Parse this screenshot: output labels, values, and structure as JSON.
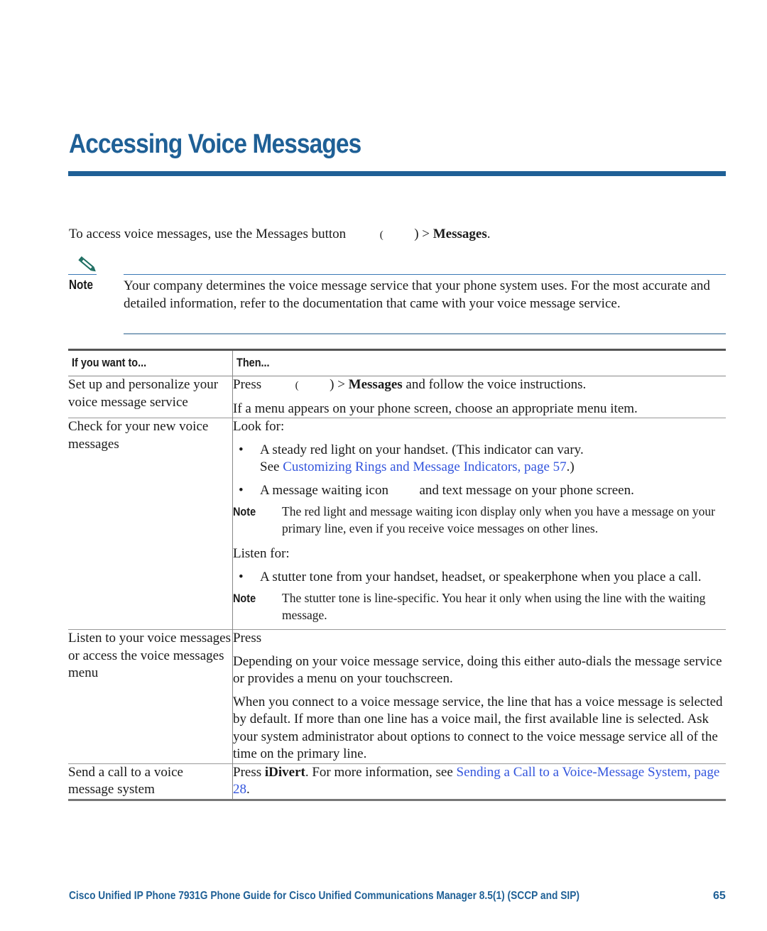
{
  "page": {
    "title": "Accessing Voice Messages",
    "accent_color": "#1f6096",
    "link_color": "#3355dd"
  },
  "intro": {
    "text": "To access voice messages, use the Messages button",
    "paren_open": "(",
    "paren_close": ")",
    "arrow": ">",
    "bold": "Messages",
    "end": "."
  },
  "note": {
    "icon": "pencil-icon",
    "label": "Note",
    "text": "Your company determines the voice message service that your phone system uses. For the most accurate and detailed information, refer to the documentation that came with your voice message service."
  },
  "table": {
    "headers": [
      "If you want to...",
      "Then..."
    ],
    "rows": [
      {
        "want": "Set up and personalize your voice message service",
        "then": {
          "press": "Press",
          "paren_open": "(",
          "paren_close": ")",
          "arrow": ">",
          "bold": "Messages",
          "rest": "and follow the voice instructions.",
          "line2": "If a menu appears on your phone screen, choose an appropriate menu item."
        }
      },
      {
        "want": "Check for your new voice messages",
        "then": {
          "look_for": "Look for:",
          "bullet1_text": "A steady red light on your handset. (This indicator can vary.",
          "bullet1_see": "See",
          "bullet1_link": "Customizing Rings and Message Indicators, page 57",
          "bullet1_end": ".)",
          "bullet2_a": "A message waiting icon",
          "bullet2_b": "and text message on your phone screen.",
          "note1_label": "Note",
          "note1_text": "The red light and message waiting icon display only when you have a message on your primary line, even if you receive voice messages on other lines.",
          "listen_for": "Listen for:",
          "bullet3_text": "A stutter tone from your handset, headset, or speakerphone when you place a call.",
          "note2_label": "Note",
          "note2_text": "The stutter tone is line-specific. You hear it only when using the line with the waiting message."
        }
      },
      {
        "want": "Listen to your voice messages or access the voice messages menu",
        "then": {
          "press": "Press",
          "para1": "Depending on your voice message service, doing this either auto-dials the message service or provides a menu on your touchscreen.",
          "para2": "When you connect to a voice message service, the line that has a voice message is selected by default. If more than one line has a voice mail, the first available line is selected. Ask your system administrator about options to connect to the voice message service all of the time on the primary line."
        }
      },
      {
        "want": "Send a call to a voice message system",
        "then": {
          "press": "Press",
          "bold": "iDivert",
          "mid": ". For more information, see",
          "link": "Sending a Call to a Voice-Message System, page 28",
          "end": "."
        }
      }
    ]
  },
  "footer": {
    "text": "Cisco Unified IP Phone 7931G Phone Guide for Cisco Unified Communications Manager 8.5(1) (SCCP and SIP)",
    "page_number": "65"
  }
}
